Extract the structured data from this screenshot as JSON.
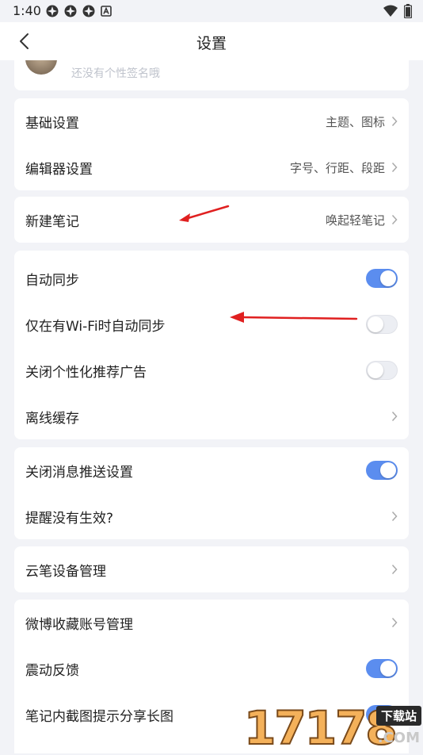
{
  "status_bar": {
    "time": "1:40",
    "notif_icons": [
      "pinwheel-icon",
      "pinwheel-icon",
      "pinwheel-icon",
      "a-box-icon"
    ],
    "wifi_icon": "wifi-icon",
    "battery_icon": "battery-icon"
  },
  "header": {
    "title": "设置",
    "back_icon": "chevron-left-icon"
  },
  "profile": {
    "signature": "还没有个性签名哦"
  },
  "groups": {
    "basic": {
      "items": [
        {
          "label": "基础设置",
          "value": "主题、图标"
        },
        {
          "label": "编辑器设置",
          "value": "字号、行距、段距"
        }
      ]
    },
    "new_note": {
      "label": "新建笔记",
      "value": "唤起轻笔记"
    },
    "sync": {
      "items": [
        {
          "label": "自动同步",
          "toggle": true
        },
        {
          "label": "仅在有Wi-Fi时自动同步",
          "toggle": false
        },
        {
          "label": "关闭个性化推荐广告",
          "toggle": false
        },
        {
          "label": "离线缓存"
        }
      ]
    },
    "push": {
      "items": [
        {
          "label": "关闭消息推送设置",
          "toggle": true
        },
        {
          "label": "提醒没有生效?"
        }
      ]
    },
    "device": {
      "label": "云笔设备管理"
    },
    "misc": {
      "items": [
        {
          "label": "微博收藏账号管理"
        },
        {
          "label": "震动反馈",
          "toggle": true
        },
        {
          "label": "笔记内截图提示分享长图",
          "toggle": true
        }
      ]
    }
  },
  "colors": {
    "accent": "#5b8def",
    "background": "#f2f3f7",
    "arrow": "#e02020"
  },
  "watermark": {
    "digits": "17178",
    "tag": "下载站",
    "domain": ".COM"
  }
}
